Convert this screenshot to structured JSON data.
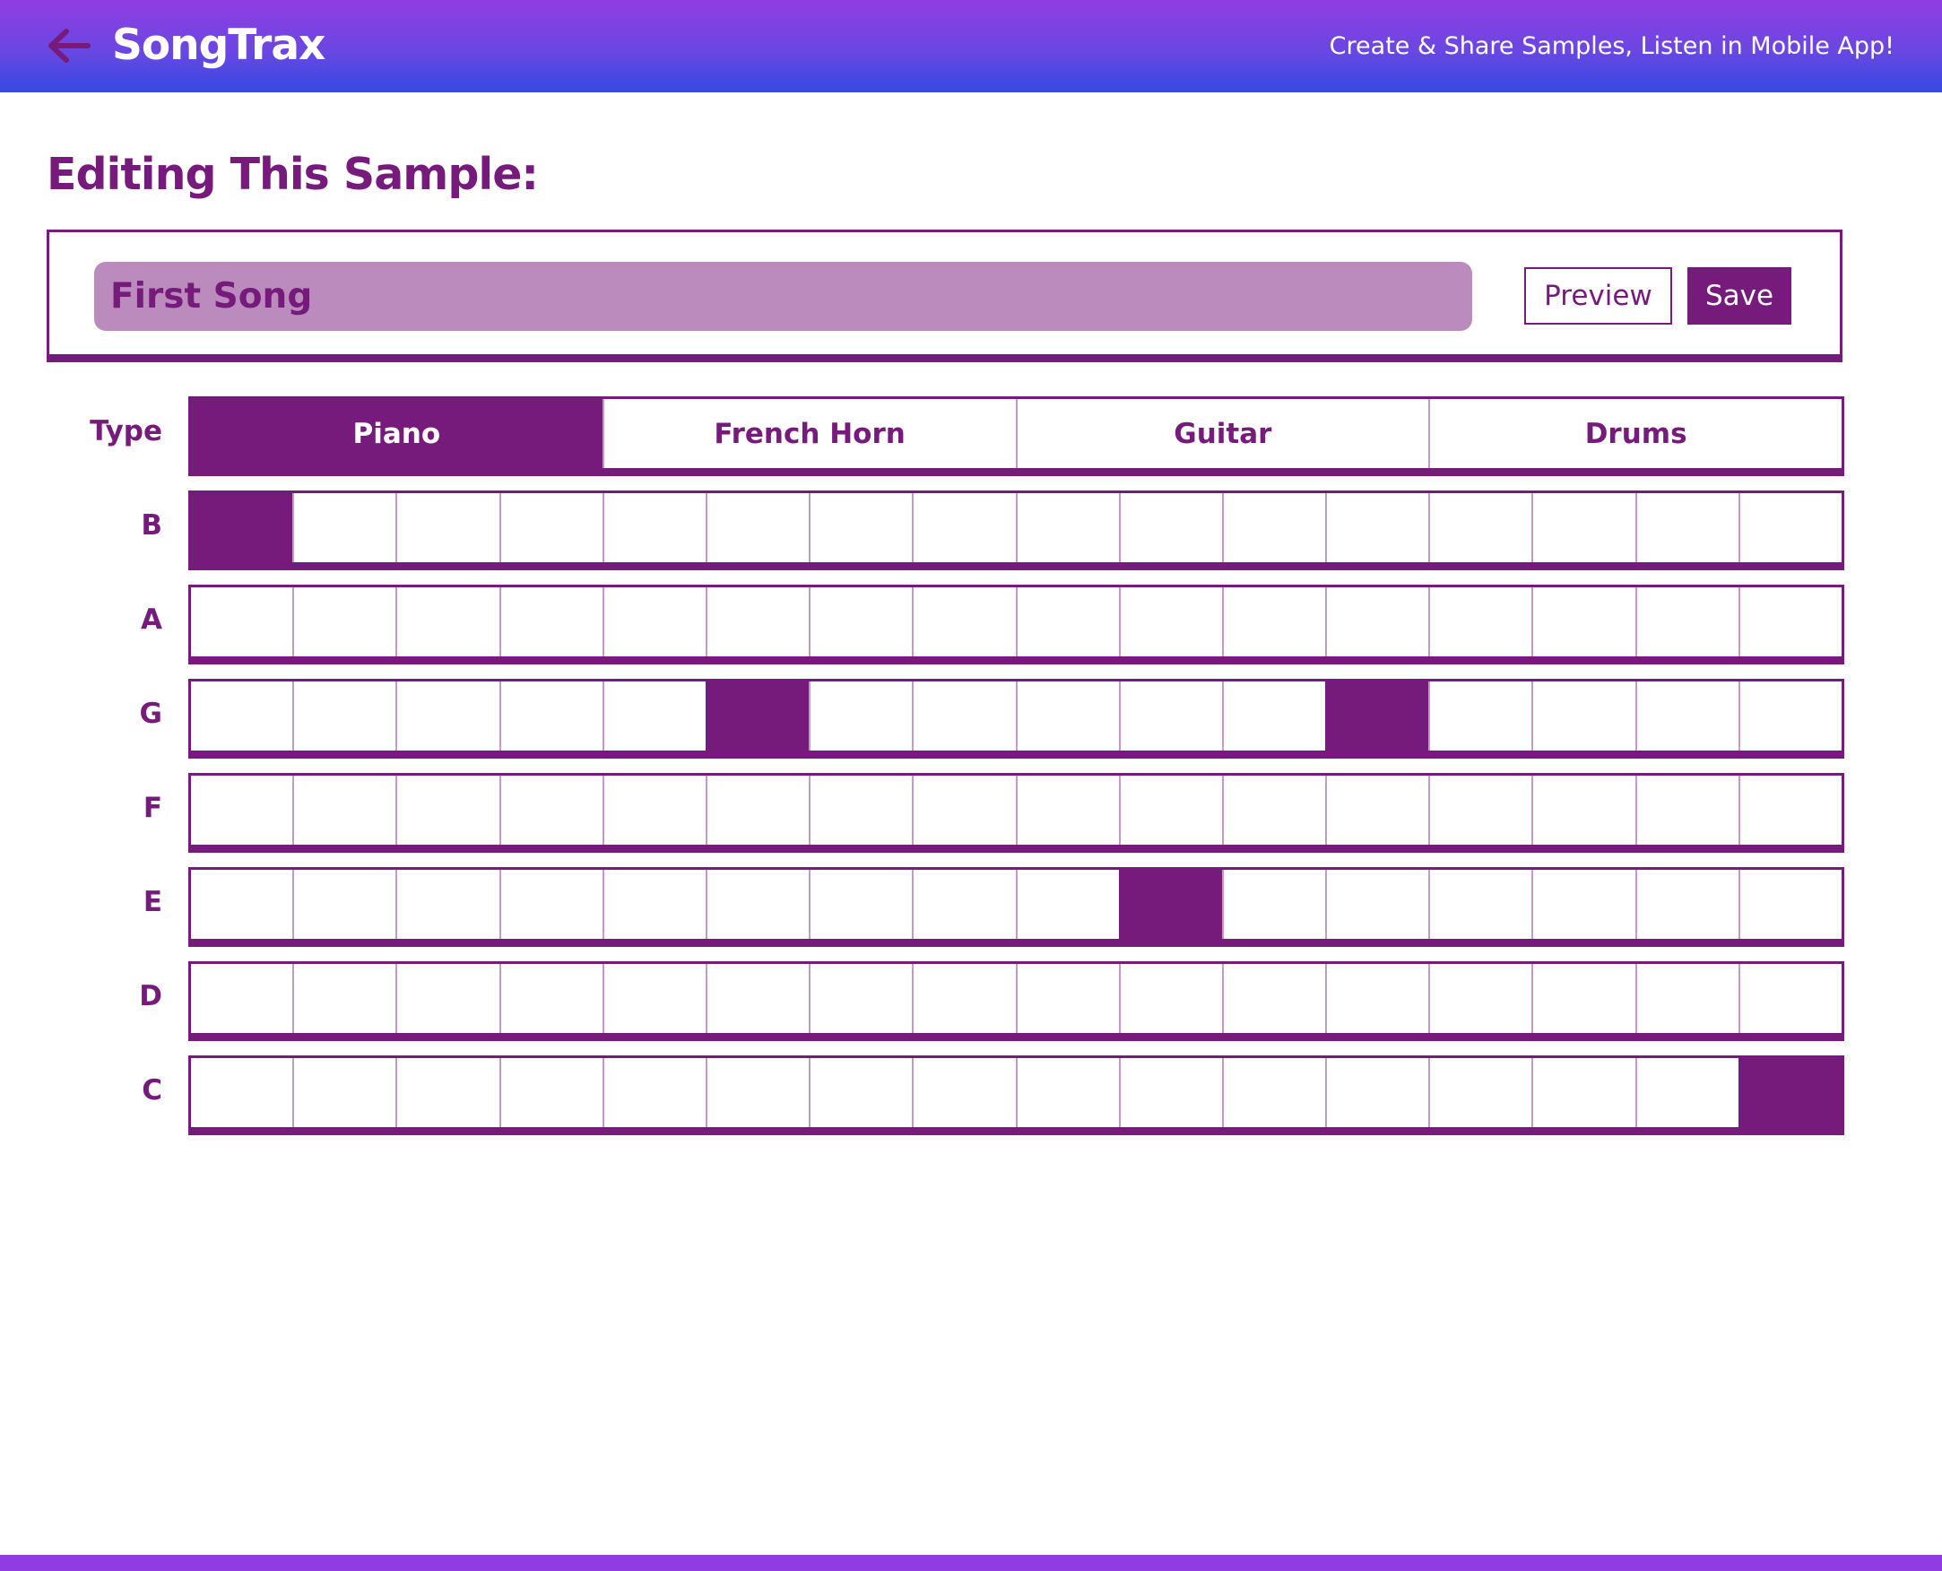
{
  "header": {
    "back_icon": "arrow-left-icon",
    "logo": "SongTrax",
    "tagline": "Create & Share Samples, Listen in Mobile App!"
  },
  "editor": {
    "title": "Editing This Sample:",
    "sample_name": "First Song",
    "preview_label": "Preview",
    "save_label": "Save"
  },
  "type_selector": {
    "label": "Type",
    "options": [
      "Piano",
      "French Horn",
      "Guitar",
      "Drums"
    ],
    "selected": "Piano"
  },
  "sequencer": {
    "steps": 16,
    "rows": [
      {
        "note": "B",
        "active_steps": [
          1
        ]
      },
      {
        "note": "A",
        "active_steps": []
      },
      {
        "note": "G",
        "active_steps": [
          6,
          12
        ]
      },
      {
        "note": "F",
        "active_steps": []
      },
      {
        "note": "E",
        "active_steps": [
          10
        ]
      },
      {
        "note": "D",
        "active_steps": []
      },
      {
        "note": "C",
        "active_steps": [
          16
        ]
      }
    ]
  },
  "colors": {
    "primary": "#761a7b",
    "input_bg": "#bb8bbd",
    "header_gradient_top": "#913ce2",
    "header_gradient_bottom": "#3549e3"
  }
}
